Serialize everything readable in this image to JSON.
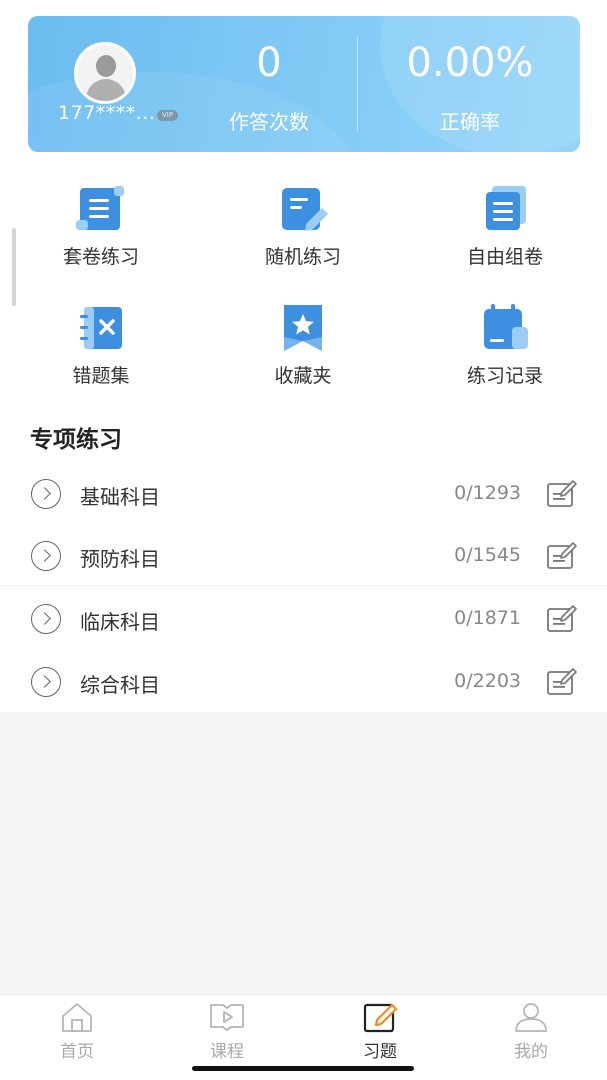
{
  "stats": {
    "username": "177****...",
    "vip_label": "VIP",
    "answer_count": "0",
    "answer_count_label": "作答次数",
    "accuracy": "0.00%",
    "accuracy_label": "正确率"
  },
  "features": [
    {
      "label": "套卷练习",
      "icon": "paper-scroll-icon"
    },
    {
      "label": "随机练习",
      "icon": "random-edit-icon"
    },
    {
      "label": "自由组卷",
      "icon": "stacked-papers-icon"
    },
    {
      "label": "错题集",
      "icon": "wrong-notebook-icon"
    },
    {
      "label": "收藏夹",
      "icon": "star-bookmark-icon"
    },
    {
      "label": "练习记录",
      "icon": "calendar-record-icon"
    }
  ],
  "section": {
    "title": "专项练习"
  },
  "subjects": [
    {
      "name": "基础科目",
      "progress": "0/1293"
    },
    {
      "name": "预防科目",
      "progress": "0/1545"
    },
    {
      "name": "临床科目",
      "progress": "0/1871"
    },
    {
      "name": "综合科目",
      "progress": "0/2203"
    }
  ],
  "tabs": [
    {
      "label": "首页",
      "icon": "home-icon"
    },
    {
      "label": "课程",
      "icon": "course-play-icon"
    },
    {
      "label": "习题",
      "icon": "exercise-edit-icon",
      "active": true
    },
    {
      "label": "我的",
      "icon": "profile-icon"
    }
  ],
  "colors": {
    "card_start": "#6bbcf0",
    "card_end": "#95d5fa",
    "icon_blue": "#3d8fe0",
    "active_accent": "#f08a24"
  }
}
